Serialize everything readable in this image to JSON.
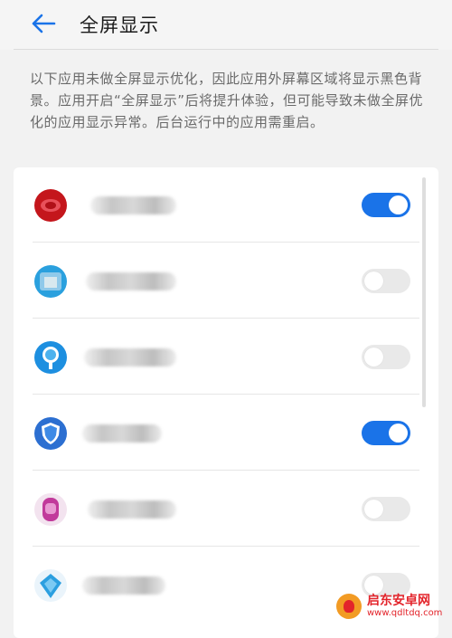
{
  "header": {
    "title": "全屏显示",
    "back_icon": "arrow-left-icon"
  },
  "description": "以下应用未做全屏显示优化，因此应用外屏幕区域将显示黑色背景。应用开启“全屏显示”后将提升体验，但可能导致未做全屏优化的应用显示异常。后台运行中的应用需重启。",
  "accent_color": "#1a73e8",
  "apps": [
    {
      "icon": "red-app-icon",
      "enabled": true
    },
    {
      "icon": "blue-app-icon",
      "enabled": false
    },
    {
      "icon": "blue-tree-app-icon",
      "enabled": false
    },
    {
      "icon": "blue-shield-app-icon",
      "enabled": true
    },
    {
      "icon": "pink-app-icon",
      "enabled": false
    },
    {
      "icon": "blue-diamond-app-icon",
      "enabled": false
    }
  ],
  "watermark": {
    "name": "启东安卓网",
    "url": "www.qdltdq.com"
  }
}
